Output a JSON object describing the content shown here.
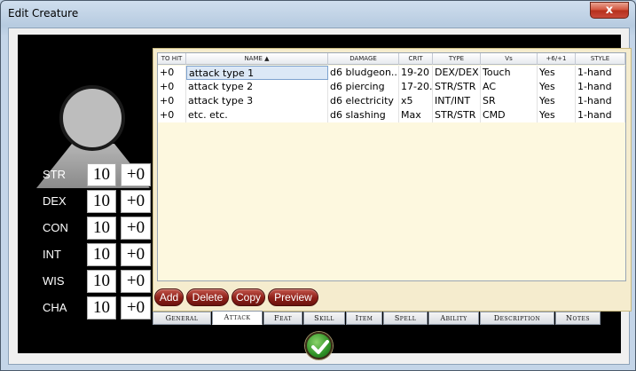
{
  "window": {
    "title": "Edit Creature",
    "close_label": "x"
  },
  "stats": [
    {
      "name": "STR",
      "value": "10",
      "mod": "+0"
    },
    {
      "name": "DEX",
      "value": "10",
      "mod": "+0"
    },
    {
      "name": "CON",
      "value": "10",
      "mod": "+0"
    },
    {
      "name": "INT",
      "value": "10",
      "mod": "+0"
    },
    {
      "name": "WIS",
      "value": "10",
      "mod": "+0"
    },
    {
      "name": "CHA",
      "value": "10",
      "mod": "+0"
    }
  ],
  "table": {
    "headers": [
      "TO HIT",
      "NAME ▲",
      "DAMAGE",
      "CRIT",
      "TYPE",
      "Vs",
      "+6/+1",
      "STYLE"
    ],
    "rows": [
      [
        "+0",
        "attack type 1",
        "d6 bludgeon...",
        "19-20",
        "DEX/DEX",
        "Touch",
        "Yes",
        "1-hand"
      ],
      [
        "+0",
        "attack type 2",
        "d6 piercing",
        "17-20...",
        "STR/STR",
        "AC",
        "Yes",
        "1-hand"
      ],
      [
        "+0",
        "attack type 3",
        "d6 electricity",
        "x5",
        "INT/INT",
        "SR",
        "Yes",
        "1-hand"
      ],
      [
        "+0",
        "etc. etc.",
        "d6 slashing",
        "Max",
        "STR/STR",
        "CMD",
        "Yes",
        "1-hand"
      ]
    ]
  },
  "actions": {
    "add": "Add",
    "delete": "Delete",
    "copy": "Copy",
    "preview": "Preview"
  },
  "tabs": [
    {
      "label": "General"
    },
    {
      "label": "Attack",
      "active": true
    },
    {
      "label": "Feat"
    },
    {
      "label": "Skill"
    },
    {
      "label": "Item"
    },
    {
      "label": "Spell"
    },
    {
      "label": "Ability"
    },
    {
      "label": "Description"
    },
    {
      "label": "Notes"
    }
  ],
  "colors": {
    "accent": "#8e1f18",
    "ok": "#2f9226",
    "panel": "#f5ecce"
  }
}
